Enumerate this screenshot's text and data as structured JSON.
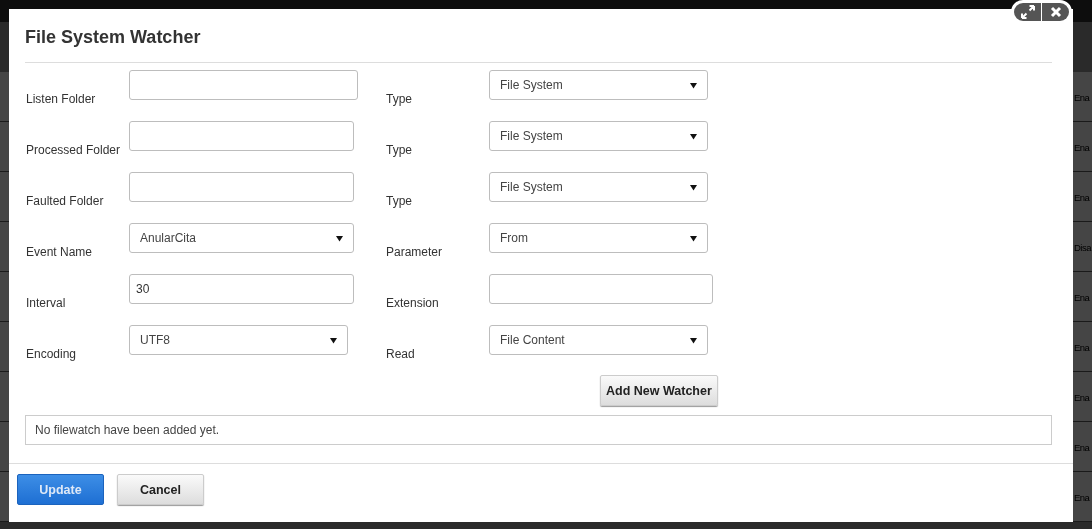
{
  "background_rows": [
    {
      "status": "Ena"
    },
    {
      "status": "Ena"
    },
    {
      "status": "Ena"
    },
    {
      "status": "Disa"
    },
    {
      "status": "Ena"
    },
    {
      "status": "Ena"
    },
    {
      "status": "Ena"
    },
    {
      "status": "Ena"
    },
    {
      "status": "Ena"
    }
  ],
  "dialog": {
    "title": "File System Watcher",
    "rows": [
      {
        "left": {
          "label": "Listen Folder",
          "kind": "text"
        },
        "right": {
          "label": "Type",
          "kind": "select",
          "value": "File System"
        }
      },
      {
        "left": {
          "label": "Processed Folder",
          "kind": "text"
        },
        "right": {
          "label": "Type",
          "kind": "select",
          "value": "File System"
        }
      },
      {
        "left": {
          "label": "Faulted Folder",
          "kind": "text"
        },
        "right": {
          "label": "Type",
          "kind": "select",
          "value": "File System"
        }
      },
      {
        "left": {
          "label": "Event Name",
          "kind": "select",
          "value": "AnularCita"
        },
        "right": {
          "label": "Parameter",
          "kind": "select",
          "value": "From"
        }
      },
      {
        "left": {
          "label": "Interval",
          "kind": "text",
          "value": "30"
        },
        "right": {
          "label": "Extension",
          "kind": "text"
        }
      },
      {
        "left": {
          "label": "Encoding",
          "kind": "select",
          "value": "UTF8"
        },
        "right": {
          "label": "Read",
          "kind": "select",
          "value": "File Content"
        }
      }
    ],
    "add_button": "Add New Watcher",
    "empty_message": "No filewatch have been added yet.",
    "buttons": [
      {
        "label": "Update",
        "kind": "primary"
      },
      {
        "label": "Cancel",
        "kind": "default"
      }
    ]
  }
}
